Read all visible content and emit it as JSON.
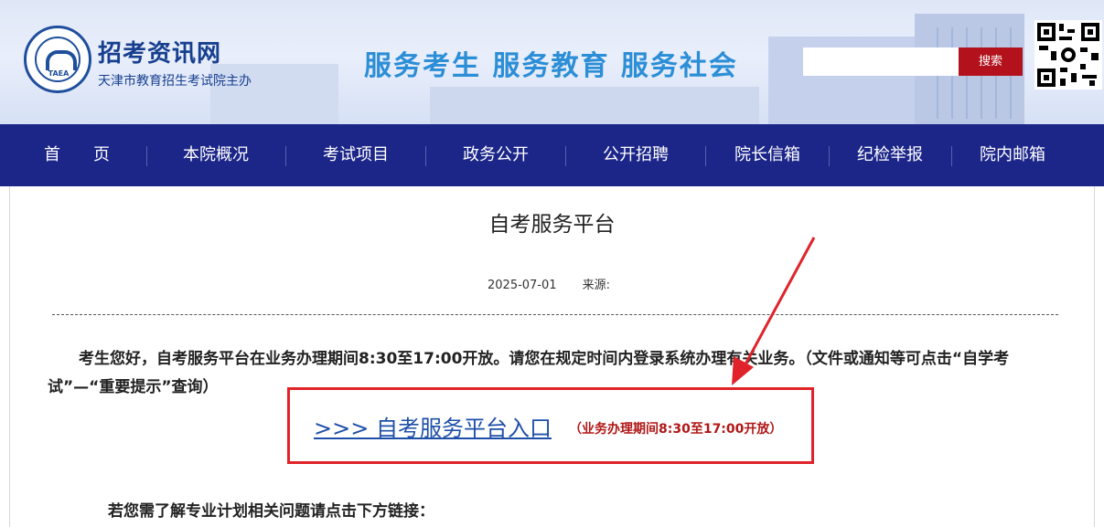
{
  "header": {
    "logo_text": "TAEA",
    "site_title": "招考资讯网",
    "site_subtitle": "天津市教育招生考试院主办",
    "slogan": "服务考生  服务教育  服务社会",
    "search_placeholder": "",
    "search_button": "搜索"
  },
  "nav": {
    "items": [
      "首　　页",
      "本院概况",
      "考试项目",
      "政务公开",
      "公开招聘",
      "院长信箱",
      "纪检举报",
      "院内邮箱"
    ]
  },
  "article": {
    "title": "自考服务平台",
    "date": "2025-07-01",
    "source_label": "来源:",
    "paragraph": "考生您好，自考服务平台在业务办理期间8:30至17:00开放。请您在规定时间内登录系统办理有关业务。（文件或通知等可点击“自学考试”—“重要提示”查询）",
    "entry_link": ">>> 自考服务平台入口",
    "entry_note": "（业务办理期间8:30至17:00开放）",
    "bottom_text": "若您需了解专业计划相关问题请点击下方链接："
  },
  "colors": {
    "nav_bg": "#1c2689",
    "accent_red": "#b3121d",
    "slogan_blue": "#2b8ed6",
    "link_blue": "#1e4fa8",
    "annotation_red": "#e0232a"
  }
}
